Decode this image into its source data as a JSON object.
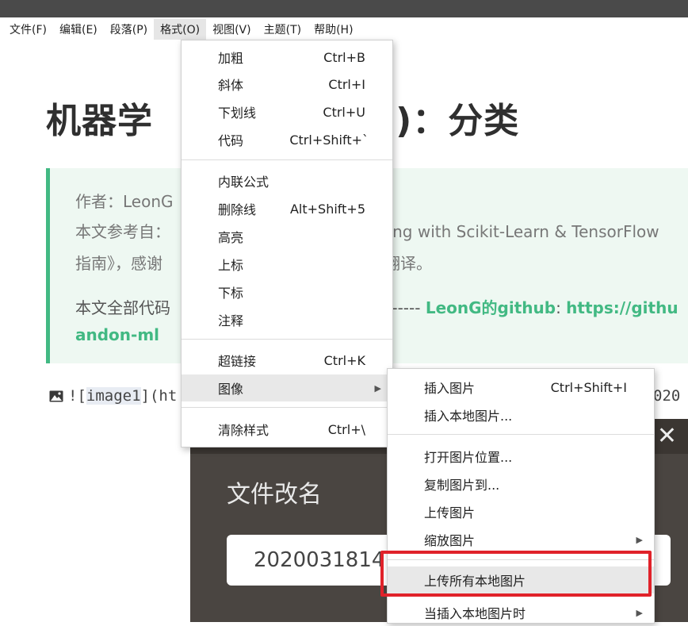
{
  "menubar": [
    "文件(F)",
    "编辑(E)",
    "段落(P)",
    "格式(O)",
    "视图(V)",
    "主题(T)",
    "帮助(H)"
  ],
  "document": {
    "title_left": "机器学",
    "title_right": "(四)：分类",
    "quote_author": "作者：LeonG",
    "quote_ref_left": "本文参考自：",
    "quote_ref_right": "rning with Scikit-Learn & TensorFlow",
    "quote_guide_left": "指南》，感谢",
    "quote_guide_right": "供翻译。",
    "quote_code_left": "本文全部代码",
    "quote_code_mid": "ub-----",
    "quote_code_link1": "LeonG的github",
    "quote_code_colon": ":",
    "quote_code_link2": "https://githu",
    "quote_code_tail": "andon-ml",
    "image_line_prefix": "![",
    "image_line_alt": "image1",
    "image_line_suffix": "](ht",
    "image_line_right": "020"
  },
  "format_menu": {
    "items": [
      {
        "label": "加粗",
        "shortcut": "Ctrl+B"
      },
      {
        "label": "斜体",
        "shortcut": "Ctrl+I"
      },
      {
        "label": "下划线",
        "shortcut": "Ctrl+U"
      },
      {
        "label": "代码",
        "shortcut": "Ctrl+Shift+`"
      },
      {
        "label": "内联公式",
        "shortcut": ""
      },
      {
        "label": "删除线",
        "shortcut": "Alt+Shift+5"
      },
      {
        "label": "高亮",
        "shortcut": ""
      },
      {
        "label": "上标",
        "shortcut": ""
      },
      {
        "label": "下标",
        "shortcut": ""
      },
      {
        "label": "注释",
        "shortcut": ""
      },
      {
        "label": "超链接",
        "shortcut": "Ctrl+K"
      },
      {
        "label": "图像",
        "shortcut": ""
      },
      {
        "label": "清除样式",
        "shortcut": "Ctrl+\\"
      }
    ]
  },
  "image_submenu": {
    "items": [
      {
        "label": "插入图片",
        "shortcut": "Ctrl+Shift+I"
      },
      {
        "label": "插入本地图片...",
        "shortcut": ""
      },
      {
        "label": "打开图片位置...",
        "shortcut": ""
      },
      {
        "label": "复制图片到...",
        "shortcut": ""
      },
      {
        "label": "上传图片",
        "shortcut": ""
      },
      {
        "label": "缩放图片",
        "shortcut": ""
      },
      {
        "label": "上传所有本地图片",
        "shortcut": ""
      },
      {
        "label": "当插入本地图片时",
        "shortcut": ""
      }
    ]
  },
  "dialog": {
    "title": "文件改名",
    "input_value": "2020031814",
    "close_symbol": "✕"
  },
  "colors": {
    "accent": "#42b983",
    "highlight_box": "#e0222a"
  }
}
